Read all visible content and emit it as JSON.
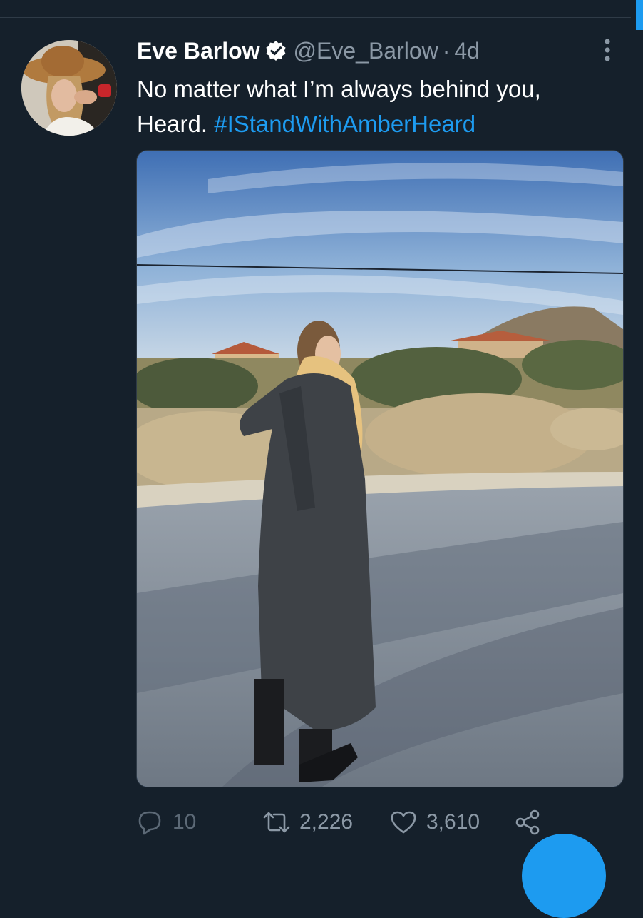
{
  "tweet": {
    "display_name": "Eve Barlow",
    "handle": "@Eve_Barlow",
    "separator": "·",
    "time_ago": "4d",
    "text_line1": "No matter what I’m always behind you,",
    "text_line2_prefix": "Heard. ",
    "hashtag": "#IStandWithAmberHeard",
    "badge": "verified-badge-icon"
  },
  "actions": {
    "reply_count": "10",
    "retweet_count": "2,226",
    "like_count": "3,610"
  },
  "colors": {
    "background": "#15202b",
    "accent": "#1d9bf0",
    "secondary_text": "#8b98a5"
  }
}
